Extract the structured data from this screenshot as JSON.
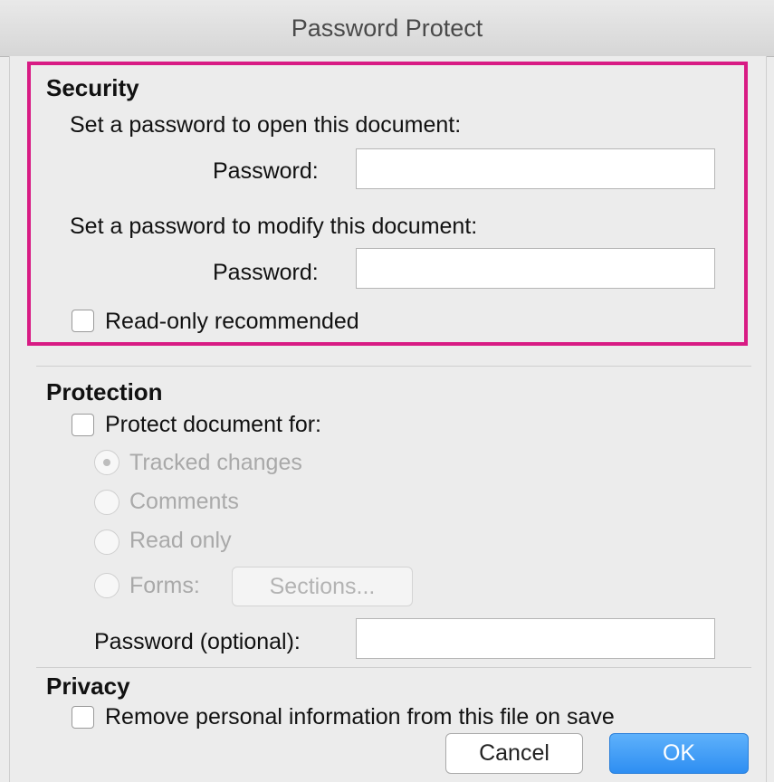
{
  "window": {
    "title": "Password Protect"
  },
  "security": {
    "heading": "Security",
    "open_prompt": "Set a password to open this document:",
    "open_password_label": "Password:",
    "open_password_value": "",
    "modify_prompt": "Set a password to modify this document:",
    "modify_password_label": "Password:",
    "modify_password_value": "",
    "read_only_label": "Read-only recommended",
    "read_only_checked": false
  },
  "protection": {
    "heading": "Protection",
    "protect_label": "Protect document for:",
    "protect_checked": false,
    "options": [
      {
        "label": "Tracked changes",
        "selected": true,
        "enabled": false
      },
      {
        "label": "Comments",
        "selected": false,
        "enabled": false
      },
      {
        "label": "Read only",
        "selected": false,
        "enabled": false
      },
      {
        "label": "Forms:",
        "selected": false,
        "enabled": false
      }
    ],
    "sections_button": "Sections...",
    "password_label": "Password (optional):",
    "password_value": ""
  },
  "privacy": {
    "heading": "Privacy",
    "remove_info_label": "Remove personal information from this file on save",
    "remove_info_checked": false
  },
  "buttons": {
    "cancel": "Cancel",
    "ok": "OK"
  },
  "colors": {
    "highlight": "#d81b84",
    "ok_button": "#2e8ef2",
    "background": "#ececec"
  }
}
